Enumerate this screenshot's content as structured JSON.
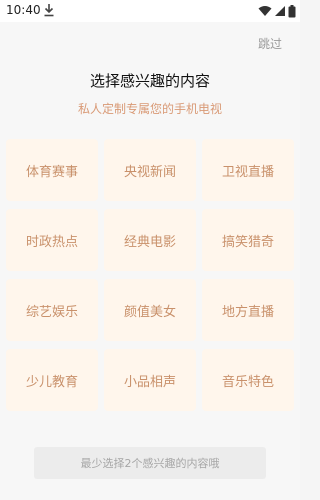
{
  "status_bar": {
    "time": "10:40",
    "icons": [
      "download-icon",
      "wifi-icon",
      "cellular-signal-icon",
      "battery-icon"
    ]
  },
  "header": {
    "skip_label": "跳过",
    "title": "选择感兴趣的内容",
    "subtitle": "私人定制专属您的手机电视"
  },
  "categories": [
    "体育赛事",
    "央视新闻",
    "卫视直播",
    "时政热点",
    "经典电影",
    "搞笑猎奇",
    "综艺娱乐",
    "颜值美女",
    "地方直播",
    "少儿教育",
    "小品相声",
    "音乐特色"
  ],
  "footer": {
    "confirm_label": "最少选择2个感兴趣的内容哦"
  },
  "colors": {
    "accent": "#d99a76",
    "tile_background": "#fff6ec",
    "tile_text": "#c9916b",
    "button_disabled_bg": "#ececec",
    "button_disabled_text": "#a6a6a6"
  }
}
